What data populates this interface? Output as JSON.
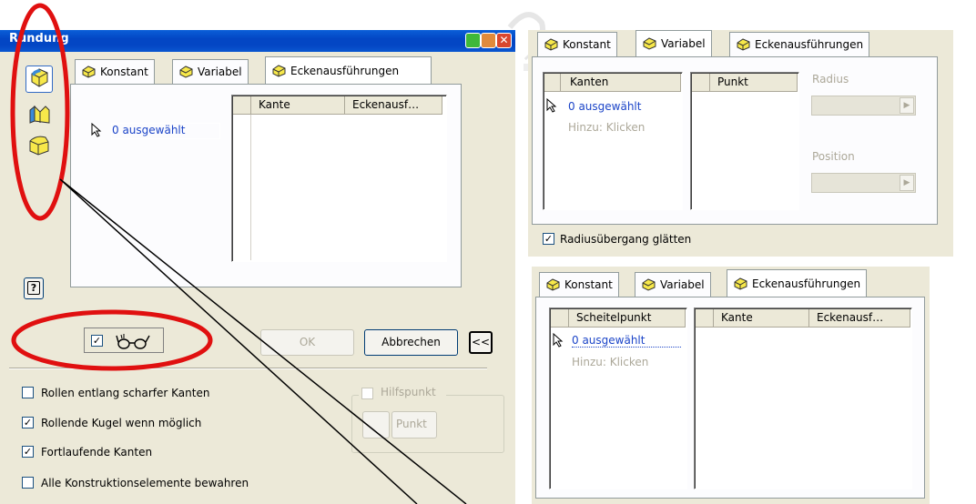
{
  "dialog": {
    "title": "Rundung",
    "tabs": [
      "Konstant",
      "Variabel",
      "Eckenausführungen"
    ],
    "selection_text": "0 ausgewählt",
    "columns": [
      "Kante",
      "Eckenausf…"
    ],
    "ok_label": "OK",
    "cancel_label": "Abbrechen",
    "more_label": "<<",
    "help_label": "?",
    "preview_checked": true,
    "options": [
      {
        "label": "Rollen entlang scharfer Kanten",
        "checked": false
      },
      {
        "label": "Rollende Kugel wenn möglich",
        "checked": true
      },
      {
        "label": "Fortlaufende Kanten",
        "checked": true
      },
      {
        "label": "Alle Konstruktionselemente bewahren",
        "checked": false
      }
    ],
    "hilfspunkt_label": "Hilfspunkt",
    "punkt_label": "Punkt"
  },
  "variabel_panel": {
    "tabs": [
      "Konstant",
      "Variabel",
      "Eckenausführungen"
    ],
    "edges_header": "Kanten",
    "selection_text": "0 ausgewählt",
    "add_hint": "Hinzu: Klicken",
    "point_header": "Punkt",
    "radius_label": "Radius",
    "position_label": "Position",
    "smooth_label": "Radiusübergang glätten",
    "smooth_checked": true
  },
  "ecken_panel": {
    "tabs": [
      "Konstant",
      "Variabel",
      "Eckenausführungen"
    ],
    "vertex_header": "Scheitelpunkt",
    "selection_text": "0 ausgewählt",
    "add_hint": "Hinzu: Klicken",
    "columns": [
      "Kante",
      "Eckenausf…"
    ]
  },
  "colors": {
    "panel": "#ece9d8",
    "titlebar": "#0346c4",
    "annotation": "#e01010",
    "selection_blue": "#1c45c8"
  }
}
